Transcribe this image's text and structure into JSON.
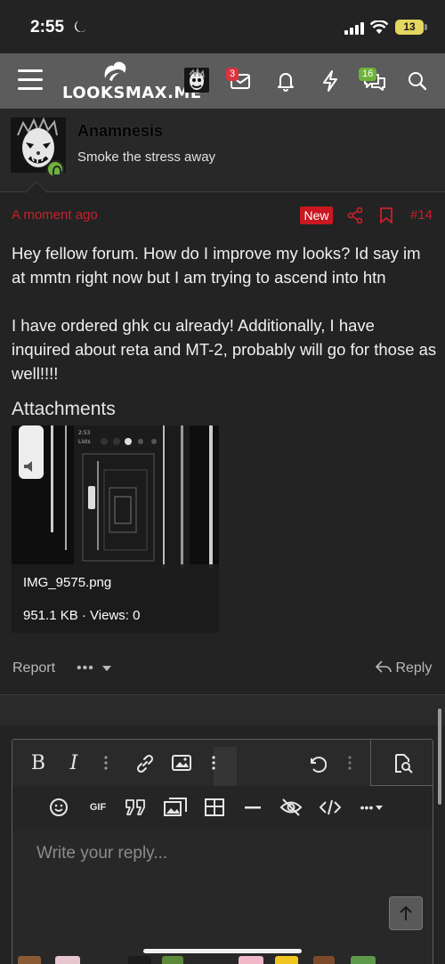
{
  "status_bar": {
    "time": "2:55",
    "battery": "13"
  },
  "nav": {
    "logo": "LOOKSMAX.ME",
    "inbox_badge": "3",
    "alerts_badge": "16"
  },
  "post": {
    "username": "Anamnesis",
    "user_title": "Smoke the stress away",
    "time": "A moment ago",
    "new_label": "New",
    "post_number": "#14",
    "paragraphs": [
      "Hey fellow forum. How do I improve my looks? Id say im at mmtn right now but I am trying to ascend into htn",
      "I have ordered ghk cu already! Additionally, I have inquired about reta and MT-2, probably will go for those as well!!!!"
    ],
    "attachments_title": "Attachments",
    "attachment": {
      "filename": "IMG_9575.png",
      "meta": "951.1 KB · Views: 0"
    },
    "report_label": "Report",
    "more_label": "•••",
    "reply_label": "Reply"
  },
  "editor": {
    "placeholder": "Write your reply...",
    "gif_label": "GIF"
  },
  "colors": {
    "accent_red": "#c8202c",
    "nav_bg": "#5c5c5c",
    "online_green": "#6fb23a"
  }
}
